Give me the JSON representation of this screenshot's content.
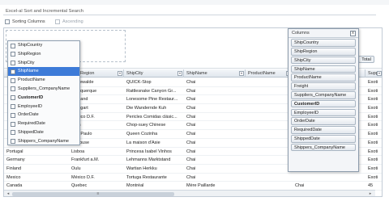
{
  "panel_title": "Excel-al Sort and Incremental Search",
  "options": {
    "sorting_columns": "Sorting Columns",
    "ascending": "Ascending"
  },
  "headers": [
    "ShipRegion",
    "ShipCity",
    "ShipName",
    "ProductName",
    "",
    "Supp"
  ],
  "rows": [
    [
      "",
      "Cunewalde",
      "QUICK-Stop",
      "Chai",
      "",
      "Exoti"
    ],
    [
      "",
      "Albuquerque",
      "Rattlesnake Canyon Gr...",
      "Chai",
      "",
      "Exoti"
    ],
    [
      "",
      "Portland",
      "Lonesome Pine Restaur...",
      "Chai",
      "",
      "Exoti"
    ],
    [
      "",
      "Stuttgart",
      "Die Wandernde Kuh",
      "Chai",
      "",
      "Exoti"
    ],
    [
      "",
      "México D.F.",
      "Pericles Comidas clásic...",
      "Chai",
      "",
      "Exoti"
    ],
    [
      "",
      "Bern",
      "Chop-suey Chinese",
      "Chai",
      "",
      "Exoti"
    ],
    [
      "",
      "São Paulo",
      "Queen Cozinha",
      "Chai",
      "",
      "Exoti"
    ],
    [
      "",
      "Toulouse",
      "La maison d'Asie",
      "Chai",
      "",
      "Exoti"
    ],
    [
      "Portugal",
      "Lisboa",
      "Princesa Isabel Vinhos",
      "Chai",
      "",
      "Exoti"
    ],
    [
      "Germany",
      "Frankfurt a.M.",
      "Lehmanns Marktstand",
      "Chai",
      "",
      "Exoti"
    ],
    [
      "Finland",
      "Oulu",
      "Wartian Herkku",
      "Chai",
      "",
      "Exoti"
    ],
    [
      "Mexico",
      "México D.F.",
      "Tortuga Restaurante",
      "Chai",
      "",
      "Exoti"
    ],
    [
      "Canada",
      "Quebec",
      "Montréal",
      "Mère Paillarde",
      "Chai",
      "45"
    ]
  ],
  "popup_items": [
    "ShipCountry",
    "ShipRegion",
    "ShipCity",
    "ShipName",
    "ProductName",
    "Suppliers_CompanyName",
    "CustomerID",
    "EmployeeID",
    "OrderDate",
    "RequiredDate",
    "ShippedDate",
    "Shippers_CompanyName"
  ],
  "columns_window": {
    "title": "Columns",
    "close": "x",
    "items": [
      "ShipCountry",
      "ShipRegion",
      "ShipCity",
      "ShipName",
      "ProductName",
      "Freight",
      "Suppliers_CompanyName",
      "CustomerID",
      "EmployeeID",
      "OrderDate",
      "RequiredDate",
      "ShippedDate",
      "Shippers_CompanyName"
    ]
  },
  "total_tag": "Total"
}
